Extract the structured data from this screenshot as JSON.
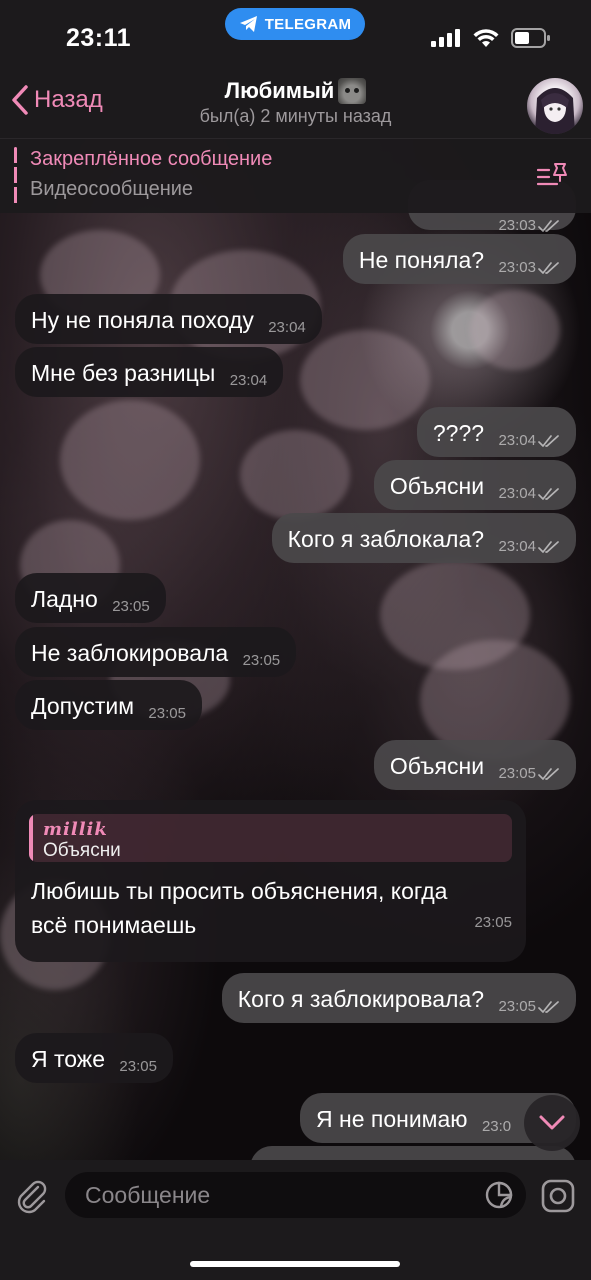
{
  "status_bar": {
    "time": "23:11",
    "app_pill": "TELEGRAM"
  },
  "header": {
    "back_label": "Назад",
    "title": "Любимый",
    "last_seen": "был(а) 2 минуты назад"
  },
  "pinned": {
    "title": "Закреплённое сообщение",
    "subtitle": "Видеосообщение"
  },
  "messages": [
    {
      "dir": "out",
      "text": "",
      "time": "23:03"
    },
    {
      "dir": "out",
      "text": "Не поняла?",
      "time": "23:03"
    },
    {
      "dir": "in",
      "text": "Ну не поняла походу",
      "time": "23:04"
    },
    {
      "dir": "in",
      "text": "Мне без разницы",
      "time": "23:04"
    },
    {
      "dir": "out",
      "text": "????",
      "time": "23:04"
    },
    {
      "dir": "out",
      "text": "Объясни",
      "time": "23:04"
    },
    {
      "dir": "out",
      "text": "Кого я заблокала?",
      "time": "23:04"
    },
    {
      "dir": "in",
      "text": "Ладно",
      "time": "23:05"
    },
    {
      "dir": "in",
      "text": "Не заблокировала",
      "time": "23:05"
    },
    {
      "dir": "in",
      "text": "Допустим",
      "time": "23:05"
    },
    {
      "dir": "out",
      "text": "Объясни",
      "time": "23:05"
    },
    {
      "dir": "in",
      "reply_name": "millik",
      "reply_text": "Объясни",
      "text_line1": "Любишь ты просить объяснения, когда",
      "text_line2": "всё понимаешь",
      "time": "23:05"
    },
    {
      "dir": "out",
      "text": "Кого я заблокировала?",
      "time": "23:05"
    },
    {
      "dir": "in",
      "text": "Я тоже",
      "time": "23:05"
    },
    {
      "dir": "out",
      "text": "Я не понимаю",
      "time": "23:0"
    }
  ],
  "input": {
    "placeholder": "Сообщение"
  },
  "colors": {
    "accent": "#f08ab7",
    "telegram_blue": "#2f8df0",
    "incoming": "#1c191c",
    "outgoing": "#4a484a"
  },
  "icons": [
    "telegram-icon",
    "signal-icon",
    "wifi-icon",
    "battery-icon",
    "chevron-left-icon",
    "pinned-list-icon",
    "read-ticks-icon",
    "chevron-down-icon",
    "paperclip-icon",
    "sticker-icon",
    "video-message-icon"
  ]
}
